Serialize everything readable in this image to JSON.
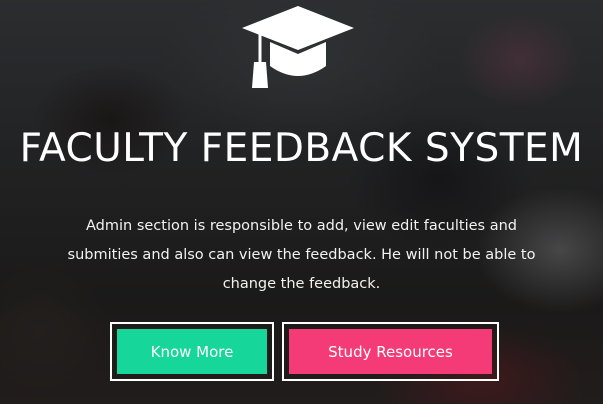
{
  "hero": {
    "icon": "graduation-cap-icon",
    "title": "FACULTY FEEDBACK SYSTEM",
    "description": "Admin section is responsible to add, view edit faculties and submities and also can view the feedback. He will not be able to change the feedback."
  },
  "buttons": {
    "know_more": {
      "label": "Know More",
      "color": "#17d69a"
    },
    "study_resources": {
      "label": "Study Resources",
      "color": "#f43b78"
    }
  }
}
